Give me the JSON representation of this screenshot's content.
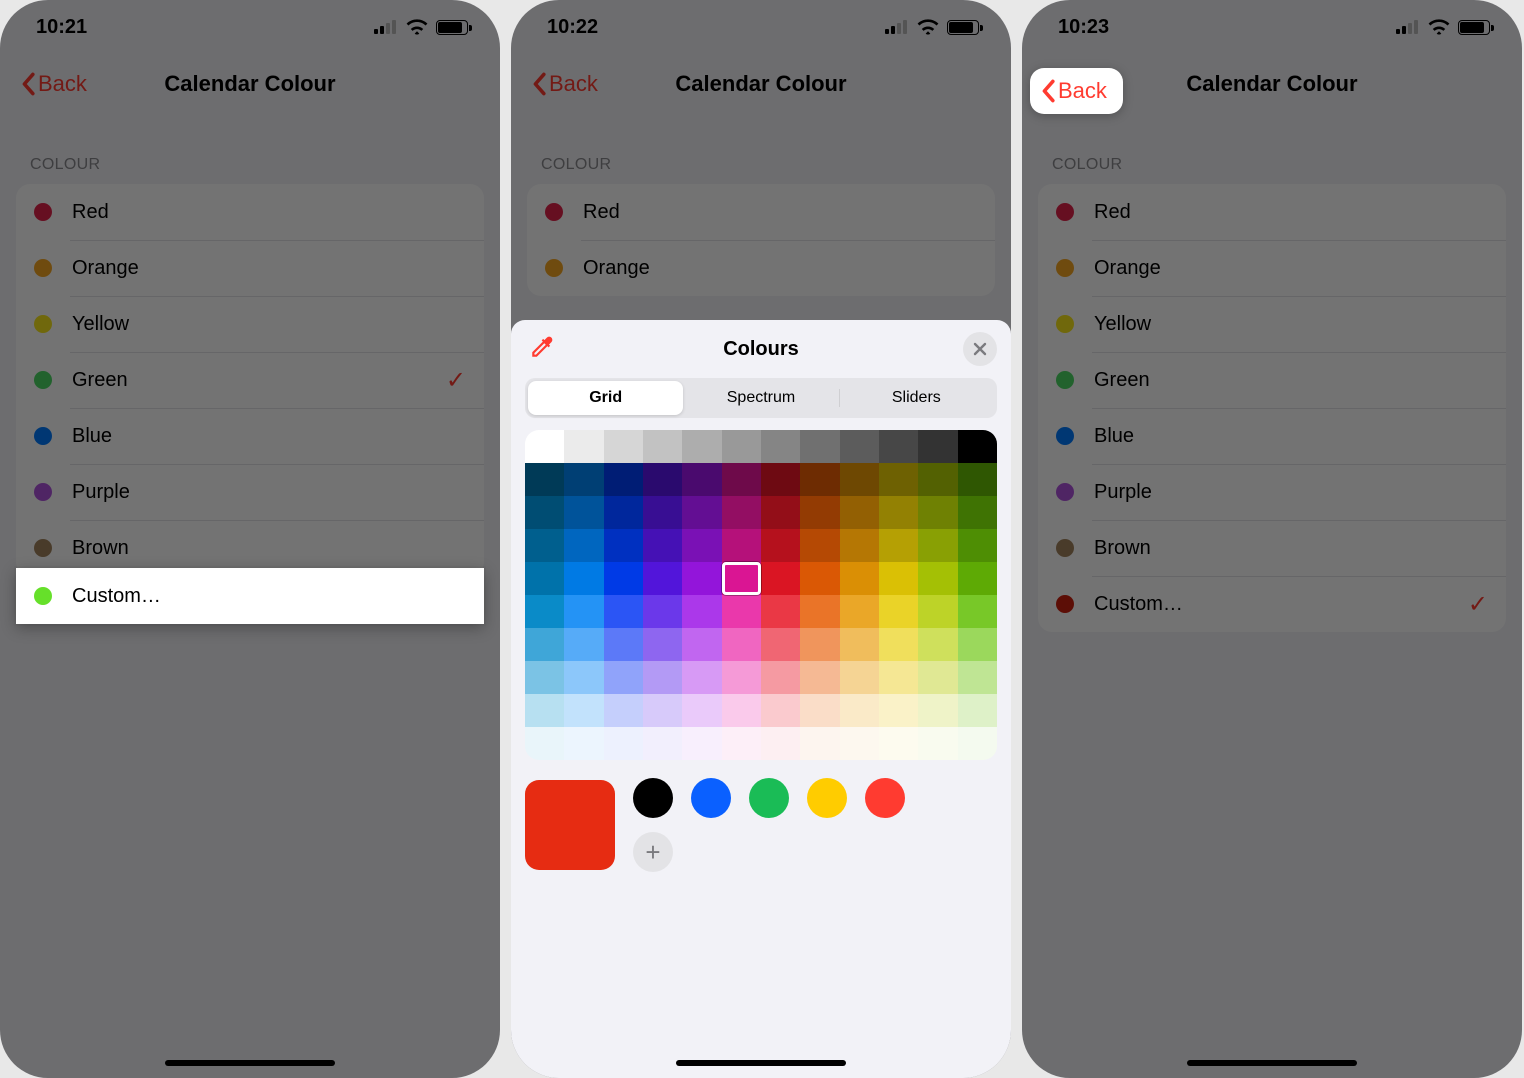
{
  "screens": [
    {
      "time": "10:21",
      "title": "Calendar Colour",
      "back_label": "Back",
      "section_header": "COLOUR",
      "rows": [
        {
          "label": "Red",
          "color": "#e2234b",
          "checked": false
        },
        {
          "label": "Orange",
          "color": "#f5a623",
          "checked": false
        },
        {
          "label": "Yellow",
          "color": "#f8e71c",
          "checked": false
        },
        {
          "label": "Green",
          "color": "#4cd964",
          "checked": true
        },
        {
          "label": "Blue",
          "color": "#007aff",
          "checked": false
        },
        {
          "label": "Purple",
          "color": "#af52de",
          "checked": false
        },
        {
          "label": "Brown",
          "color": "#a2845e",
          "checked": false
        }
      ],
      "highlight_row": {
        "label": "Custom…",
        "color": "#66e02a"
      }
    },
    {
      "time": "10:22",
      "title": "Calendar Colour",
      "back_label": "Back",
      "section_header": "COLOUR",
      "visible_rows": [
        {
          "label": "Red",
          "color": "#e2234b"
        },
        {
          "label": "Orange",
          "color": "#f5a623"
        }
      ],
      "picker": {
        "title": "Colours",
        "tabs": [
          "Grid",
          "Spectrum",
          "Sliders"
        ],
        "active_tab": 0,
        "selected_color": "#e62c12",
        "presets": [
          "#000000",
          "#0a60ff",
          "#1abc56",
          "#ffcc00",
          "#ff3b30"
        ],
        "selected_cell": {
          "row": 4,
          "col": 5
        }
      }
    },
    {
      "time": "10:23",
      "title": "Calendar Colour",
      "back_label": "Back",
      "section_header": "COLOUR",
      "rows": [
        {
          "label": "Red",
          "color": "#e2234b",
          "checked": false
        },
        {
          "label": "Orange",
          "color": "#f5a623",
          "checked": false
        },
        {
          "label": "Yellow",
          "color": "#f8e71c",
          "checked": false
        },
        {
          "label": "Green",
          "color": "#4cd964",
          "checked": false
        },
        {
          "label": "Blue",
          "color": "#007aff",
          "checked": false
        },
        {
          "label": "Purple",
          "color": "#af52de",
          "checked": false
        },
        {
          "label": "Brown",
          "color": "#a2845e",
          "checked": false
        },
        {
          "label": "Custom…",
          "color": "#cc1f0e",
          "checked": true
        }
      ]
    }
  ],
  "grid_colors": [
    [
      "#ffffff",
      "#ebebeb",
      "#d6d6d6",
      "#c2c2c2",
      "#adadad",
      "#999999",
      "#858585",
      "#707070",
      "#5c5c5c",
      "#474747",
      "#333333",
      "#000000"
    ],
    [
      "#003a57",
      "#003f74",
      "#001d75",
      "#2a0a6e",
      "#4a0a6e",
      "#6e0a4a",
      "#6e0a12",
      "#6e2c02",
      "#6e4802",
      "#6e6102",
      "#536102",
      "#2f5702"
    ],
    [
      "#004d73",
      "#00539a",
      "#00279c",
      "#380e93",
      "#630e93",
      "#930e63",
      "#930e18",
      "#933b03",
      "#936003",
      "#938103",
      "#6f8103",
      "#3f7303"
    ],
    [
      "#005f8e",
      "#0066bf",
      "#0030c0",
      "#4511b5",
      "#7a11b5",
      "#b5117a",
      "#b5111d",
      "#b54904",
      "#b57704",
      "#b5a004",
      "#89a004",
      "#4e8e04"
    ],
    [
      "#0072aa",
      "#007ae4",
      "#003ae6",
      "#5215da",
      "#9315da",
      "#da1593",
      "#da1523",
      "#da5805",
      "#da8f05",
      "#dac005",
      "#a4c005",
      "#5eaa05"
    ],
    [
      "#0a8bc8",
      "#2493f5",
      "#2b55f5",
      "#6b38ea",
      "#ab38ea",
      "#ea38ab",
      "#ea3845",
      "#ea7428",
      "#eaa728",
      "#ead328",
      "#bdd328",
      "#78c828"
    ],
    [
      "#3fa6d8",
      "#56abf8",
      "#5c79f8",
      "#8e66f0",
      "#c166f0",
      "#f066c1",
      "#f06673",
      "#f0955c",
      "#f0bd5c",
      "#f0df5c",
      "#cfe05c",
      "#9bd85c"
    ],
    [
      "#7bc3e5",
      "#8cc7fa",
      "#90a3fa",
      "#b39af5",
      "#d79af5",
      "#f59ad7",
      "#f59aa2",
      "#f5b994",
      "#f5d494",
      "#f5e794",
      "#e0e894",
      "#bfe594"
    ],
    [
      "#b7e0f1",
      "#c2e2fc",
      "#c5cffc",
      "#d7cafa",
      "#eacafa",
      "#facaeb",
      "#facace",
      "#faddc8",
      "#faeac8",
      "#faf2c8",
      "#eff3c8",
      "#def1c8"
    ],
    [
      "#e9f5fa",
      "#ecf5fe",
      "#edf1fe",
      "#f2effd",
      "#f8effd",
      "#fdeff8",
      "#fdeff2",
      "#fdf5ef",
      "#fdf8ef",
      "#fdfbef",
      "#f9fbef",
      "#f4faef"
    ]
  ]
}
